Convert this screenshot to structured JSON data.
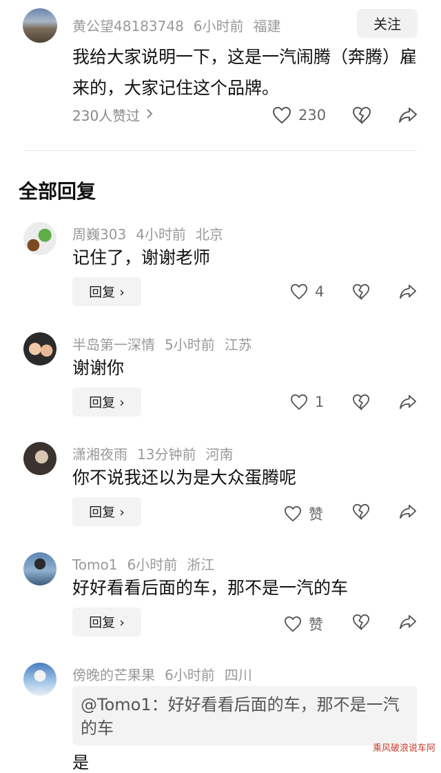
{
  "top_comment": {
    "username": "黄公望48183748",
    "time": "6小时前",
    "location": "福建",
    "follow_label": "关注",
    "text": "我给大家说明一下，这是一汽闹腾（奔腾）雇来的，大家记住这个品牌。",
    "likers_text": "230人赞过",
    "like_count": "230"
  },
  "section_title": "全部回复",
  "replies": [
    {
      "username": "周巍303",
      "time": "4小时前",
      "location": "北京",
      "text": "记住了，谢谢老师",
      "reply_label": "回复",
      "like_label": "4"
    },
    {
      "username": "半岛第一深情",
      "time": "5小时前",
      "location": "江苏",
      "text": "谢谢你",
      "reply_label": "回复",
      "like_label": "1"
    },
    {
      "username": "潇湘夜雨",
      "time": "13分钟前",
      "location": "河南",
      "text": "你不说我还以为是大众蛋腾呢",
      "reply_label": "回复",
      "like_label": "赞"
    },
    {
      "username": "Tomo1",
      "time": "6小时前",
      "location": "浙江",
      "text": "好好看看后面的车，那不是一汽的车",
      "reply_label": "回复",
      "like_label": "赞"
    },
    {
      "username": "傍晚的芒果果",
      "time": "6小时前",
      "location": "四川",
      "quote": "@Tomo1：好好看看后面的车，那不是一汽的车",
      "text_partial": "是"
    }
  ],
  "watermark": "乘风破浪说车阿",
  "icons": {
    "like": "heart-outline-icon",
    "dislike": "broken-heart-icon",
    "share": "share-arrow-icon",
    "chevron": "chevron-right-icon"
  }
}
